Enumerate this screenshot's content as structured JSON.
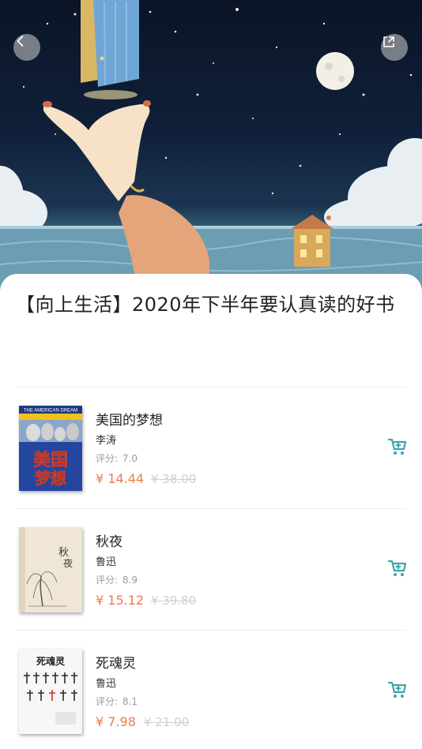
{
  "hero": {
    "back_icon": "chevron-left-icon",
    "share_icon": "external-share-icon"
  },
  "list": {
    "title": "【向上生活】2020年下半年要认真读的好书"
  },
  "books": [
    {
      "name": "美国的梦想",
      "author": "李涛",
      "rating_label": "评分:",
      "rating": "7.0",
      "price": "¥ 14.44",
      "original_price": "¥ 38.00",
      "cover_text": "美国的梦想",
      "cover_banner": "THE AMERICAN DREAM"
    },
    {
      "name": "秋夜",
      "author": "鲁迅",
      "rating_label": "评分:",
      "rating": "8.9",
      "price": "¥ 15.12",
      "original_price": "¥ 39.80",
      "cover_text": "秋夜"
    },
    {
      "name": "死魂灵",
      "author": "鲁迅",
      "rating_label": "评分:",
      "rating": "8.1",
      "price": "¥ 7.98",
      "original_price": "¥ 21.00",
      "cover_text": "死魂灵"
    }
  ],
  "colors": {
    "price": "#ee7a4a",
    "cart": "#3fa5a7",
    "rating": "#9a9a9a",
    "original_price": "#cfcfcf"
  }
}
